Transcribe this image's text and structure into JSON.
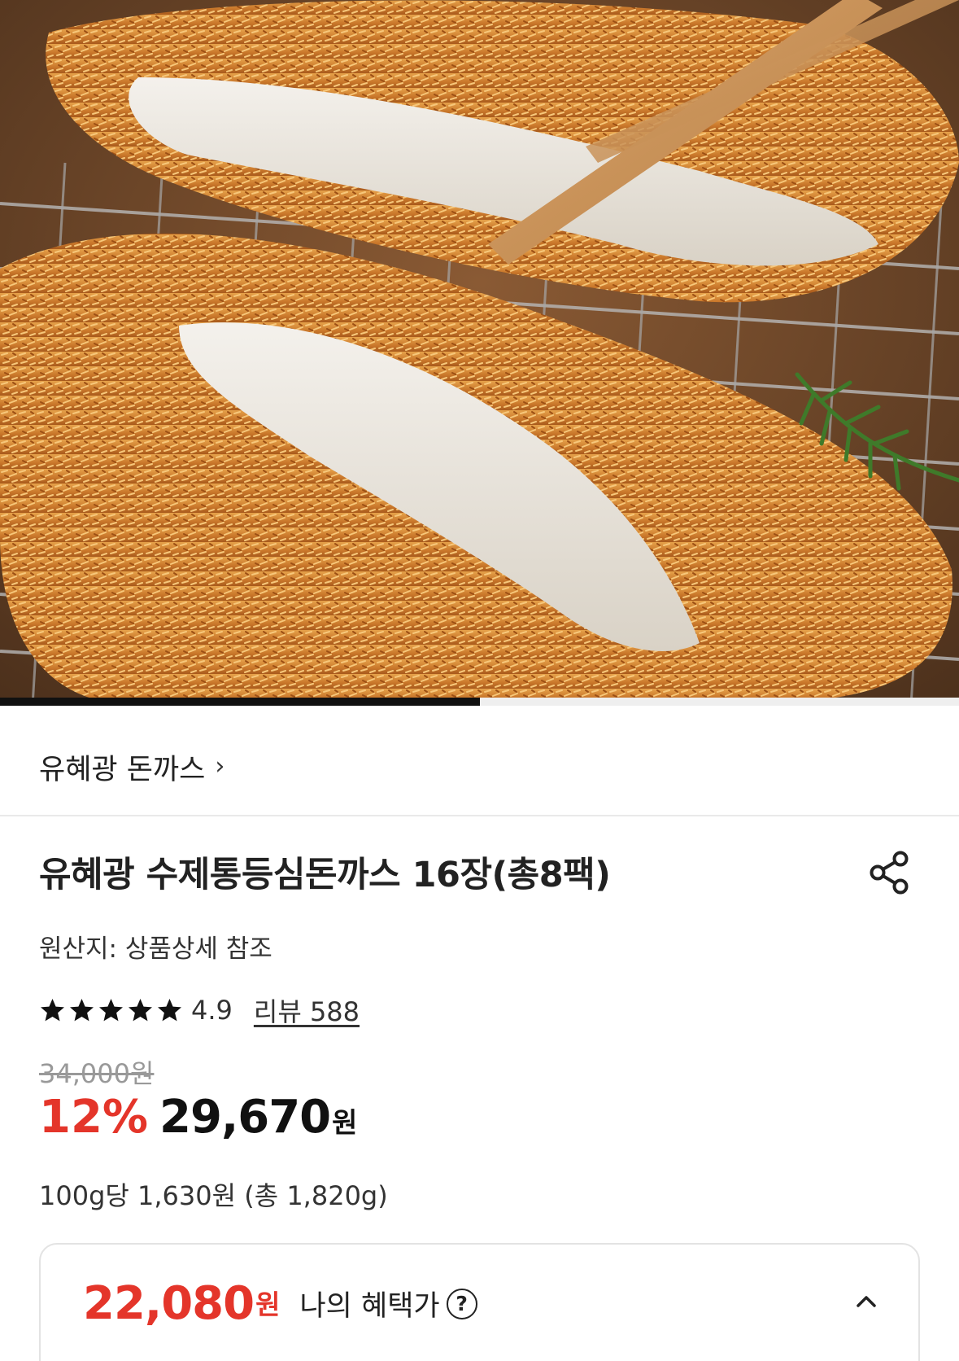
{
  "hero": {
    "image_icon": "tonkatsu-photo",
    "progress": 0.5
  },
  "brand": {
    "name": "유혜광 돈까스",
    "chevron": "›"
  },
  "product": {
    "title": "유혜광 수제통등심돈까스 16장(총8팩)",
    "share_icon": "share-icon",
    "origin": "원산지: 상품상세 참조"
  },
  "rating": {
    "stars": 5,
    "value": "4.9",
    "review_label": "리뷰 588"
  },
  "price": {
    "original": "34,000원",
    "discount": "12%",
    "sale": "29,670",
    "currency": "원",
    "unit": "100g당 1,630원 (총 1,820g)"
  },
  "benefit": {
    "price": "22,080",
    "currency": "원",
    "label": "나의 혜택가",
    "help": "?"
  },
  "colors": {
    "accent_red": "#e4352a",
    "text": "#222222",
    "muted": "#999999"
  }
}
